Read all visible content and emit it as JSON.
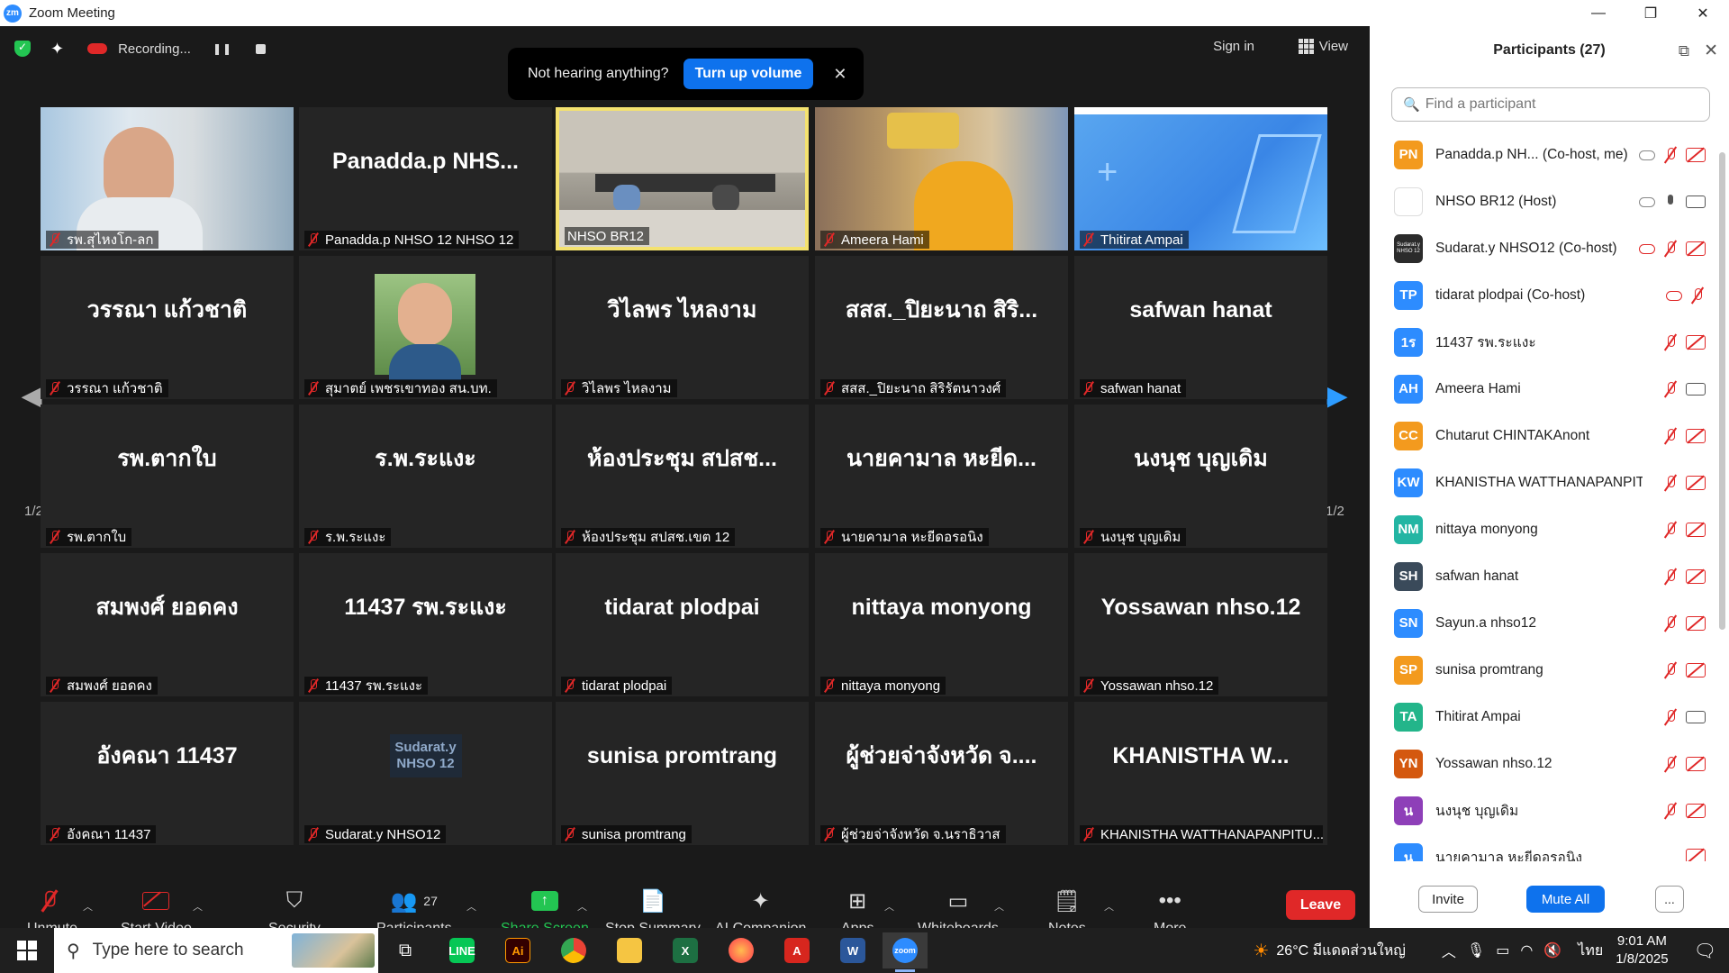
{
  "window": {
    "title": "Zoom Meeting",
    "logo": "zm",
    "minimize": "—",
    "restore": "❐",
    "close": "✕"
  },
  "topbar": {
    "recording_label": "Recording...",
    "sign_in": "Sign in",
    "view": "View"
  },
  "toast": {
    "message": "Not hearing anything?",
    "button": "Turn up volume",
    "close": "✕"
  },
  "pager": {
    "page": "1/2"
  },
  "tiles": [
    {
      "big": "",
      "name": "รพ.สุไหงโก-ลก",
      "video": "man"
    },
    {
      "big": "Panadda.p NHS...",
      "name": "Panadda.p NHSO 12 NHSO 12"
    },
    {
      "big": "",
      "name": "NHSO BR12",
      "video": "room",
      "active": true,
      "nomic": true
    },
    {
      "big": "",
      "name": "Ameera Hami",
      "video": "woman"
    },
    {
      "big": "",
      "name": "Thitirat Ampai",
      "video": "blue"
    },
    {
      "big": "วรรณา แก้วชาติ",
      "name": "วรรณา แก้วชาติ"
    },
    {
      "big": "",
      "name": "สุมาตย์ เพชรเขาทอง สน.บท.",
      "video": "selfie"
    },
    {
      "big": "วิไลพร ไหลงาม",
      "name": "วิไลพร ไหลงาม"
    },
    {
      "big": "สสส._ปิยะนาถ สิริ...",
      "name": "สสส._ปิยะนาถ สิริรัตนาวงศ์"
    },
    {
      "big": "safwan hanat",
      "name": "safwan hanat"
    },
    {
      "big": "รพ.ตากใบ",
      "name": "รพ.ตากใบ"
    },
    {
      "big": "ร.พ.ระแงะ",
      "name": "ร.พ.ระแงะ"
    },
    {
      "big": "ห้องประชุม สปสช...",
      "name": "ห้องประชุม สปสช.เขต 12"
    },
    {
      "big": "นายคามาล หะยีด...",
      "name": "นายคามาล หะยีดอรอนิง"
    },
    {
      "big": "นงนุช บุญเดิม",
      "name": "นงนุช บุญเดิม"
    },
    {
      "big": "สมพงศ์ ยอดคง",
      "name": "สมพงศ์ ยอดคง"
    },
    {
      "big": "11437 รพ.ระแงะ",
      "name": "11437 รพ.ระแงะ"
    },
    {
      "big": "tidarat plodpai",
      "name": "tidarat plodpai"
    },
    {
      "big": "nittaya monyong",
      "name": "nittaya monyong"
    },
    {
      "big": "Yossawan nhso.12",
      "name": "Yossawan nhso.12"
    },
    {
      "big": "อังคณา 11437",
      "name": "อังคณา 11437"
    },
    {
      "big": "Sudarat.y NHSO 12",
      "name": "Sudarat.y NHSO12",
      "logo": true
    },
    {
      "big": "sunisa promtrang",
      "name": "sunisa promtrang"
    },
    {
      "big": "ผู้ช่วยจ่าจังหวัด จ....",
      "name": "ผู้ช่วยจ่าจังหวัด จ.นราธิวาส"
    },
    {
      "big": "KHANISTHA W...",
      "name": "KHANISTHA WATTHANAPANPITU..."
    }
  ],
  "toolbar": {
    "unmute": "Unmute",
    "start_video": "Start Video",
    "security": "Security",
    "participants": "Participants",
    "participants_count": "27",
    "share_screen": "Share Screen",
    "stop_summary": "Stop Summary",
    "ai_companion": "AI Companion",
    "apps": "Apps",
    "whiteboards": "Whiteboards",
    "notes": "Notes",
    "more": "More",
    "leave": "Leave"
  },
  "panel": {
    "title": "Participants (27)",
    "search_placeholder": "Find a participant",
    "invite": "Invite",
    "mute_all": "Mute All",
    "more": "...",
    "participants": [
      {
        "initials": "PN",
        "color": "#f39a1e",
        "name": "Panadda.p NH... (Co-host, me)",
        "cloud": true,
        "mic": "off",
        "cam": "off"
      },
      {
        "initials": "",
        "color": "#ffffff",
        "name": "NHSO BR12 (Host)",
        "cloud": true,
        "mic": "on",
        "cam": "on",
        "img": "cartoon"
      },
      {
        "initials": "Sudarat.y NHSO 12",
        "color": "#2b2b2b",
        "name": "Sudarat.y NHSO12 (Co-host)",
        "cloud": true,
        "cloudred": true,
        "mic": "off",
        "cam": "off",
        "small": true
      },
      {
        "initials": "TP",
        "color": "#2d8cff",
        "name": "tidarat plodpai (Co-host)",
        "cloud": true,
        "cloudred": true,
        "mic": "off",
        "cam": "none"
      },
      {
        "initials": "1ร",
        "color": "#2d8cff",
        "name": "11437 รพ.ระแงะ",
        "mic": "off",
        "cam": "off"
      },
      {
        "initials": "AH",
        "color": "#2d8cff",
        "name": "Ameera Hami",
        "mic": "off",
        "cam": "on"
      },
      {
        "initials": "CC",
        "color": "#f39a1e",
        "name": "Chutarut CHINTAKAnont",
        "mic": "off",
        "cam": "off"
      },
      {
        "initials": "KW",
        "color": "#2d8cff",
        "name": "KHANISTHA WATTHANAPANPIT...",
        "mic": "off",
        "cam": "off"
      },
      {
        "initials": "NM",
        "color": "#23b5a3",
        "name": "nittaya monyong",
        "mic": "off",
        "cam": "off"
      },
      {
        "initials": "SH",
        "color": "#3a4a5a",
        "name": "safwan hanat",
        "mic": "off",
        "cam": "off"
      },
      {
        "initials": "SN",
        "color": "#2d8cff",
        "name": "Sayun.a nhso12",
        "mic": "off",
        "cam": "off"
      },
      {
        "initials": "SP",
        "color": "#f39a1e",
        "name": "sunisa promtrang",
        "mic": "off",
        "cam": "off"
      },
      {
        "initials": "TA",
        "color": "#23b58a",
        "name": "Thitirat Ampai",
        "mic": "off",
        "cam": "on"
      },
      {
        "initials": "YN",
        "color": "#d4580f",
        "name": "Yossawan nhso.12",
        "mic": "off",
        "cam": "off"
      },
      {
        "initials": "น",
        "color": "#8e3fb8",
        "name": "นงนุช บุญเดิม",
        "mic": "off",
        "cam": "off"
      },
      {
        "initials": "น",
        "color": "#2d8cff",
        "name": "นายคามาล หะยีดอรอนิง",
        "mic": "none",
        "cam": "off"
      }
    ]
  },
  "taskbar": {
    "search_placeholder": "Type here to search",
    "weather": "26°C มีแดดส่วนใหญ่",
    "lang": "ไทย",
    "time": "9:01 AM",
    "date": "1/8/2025"
  }
}
